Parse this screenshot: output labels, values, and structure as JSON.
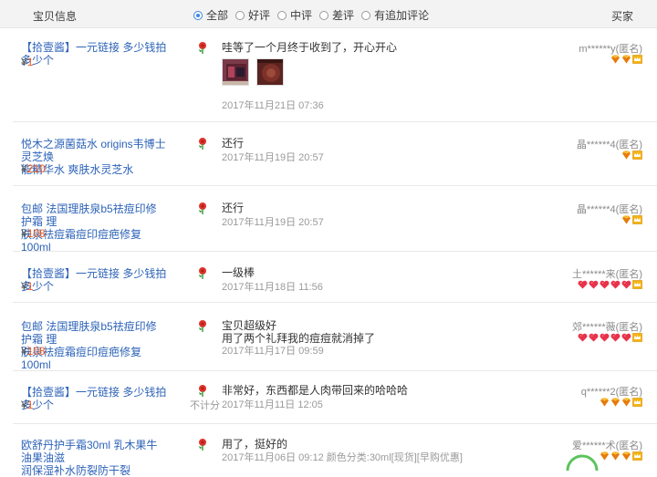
{
  "header": {
    "item_col": "宝贝信息",
    "buyer_col": "买家",
    "filters": [
      "全部",
      "好评",
      "中评",
      "差评",
      "有追加评论"
    ]
  },
  "rows": [
    {
      "title_lines": [
        "【拾壹酱】一元链接 多少钱拍多少个"
      ],
      "price": "1",
      "comment_lines": [
        "哇等了一个月终于收到了，开心开心"
      ],
      "date": "2017年11月21日 07:36",
      "buyer": "m******y(匿名)",
      "badges": [
        "gem",
        "gem",
        "crown"
      ],
      "has_images": true
    },
    {
      "title_lines": [
        "悦木之源菌菇水 origins韦博士灵芝焕",
        "能精华水 爽肤水灵芝水"
      ],
      "price": "210",
      "comment_lines": [
        "还行"
      ],
      "date": "2017年11月19日 20:57",
      "buyer": "晶******4(匿名)",
      "badges": [
        "gem",
        "crown"
      ]
    },
    {
      "title_lines": [
        "包邮 法国理肤泉b5祛痘印修护霜 理",
        "肤泉祛痘霜痘印痘疤修复 100ml"
      ],
      "price": "108",
      "comment_lines": [
        "还行"
      ],
      "date": "2017年11月19日 20:57",
      "buyer": "晶******4(匿名)",
      "badges": [
        "gem",
        "crown"
      ]
    },
    {
      "title_lines": [
        "【拾壹酱】一元链接 多少钱拍多少个"
      ],
      "price": "1",
      "comment_lines": [
        "一级棒"
      ],
      "date": "2017年11月18日 11:56",
      "buyer": "土******来(匿名)",
      "badges": [
        "heart",
        "heart",
        "heart",
        "heart",
        "heart",
        "crown"
      ]
    },
    {
      "title_lines": [
        "包邮 法国理肤泉b5祛痘印修护霜 理",
        "肤泉祛痘霜痘印痘疤修复 100ml"
      ],
      "price": "108",
      "comment_lines": [
        "宝贝超级好",
        "用了两个礼拜我的痘痘就消掉了"
      ],
      "date": "2017年11月17日 09:59",
      "buyer": "郊******薇(匿名)",
      "badges": [
        "heart",
        "heart",
        "heart",
        "heart",
        "heart",
        "crown"
      ]
    },
    {
      "title_lines": [
        "【拾壹酱】一元链接 多少钱拍多少个"
      ],
      "price": "1",
      "comment_lines": [
        "非常好，东西都是人肉带回来的哈哈哈"
      ],
      "date": "2017年11月11日 12:05",
      "buyer": "q******2(匿名)",
      "badges": [
        "gem",
        "gem",
        "gem",
        "crown"
      ],
      "no_score": "不计分"
    },
    {
      "title_lines": [
        "欧舒丹护手霜30ml 乳木果牛油果油滋",
        "润保湿补水防裂防干裂"
      ],
      "price": "",
      "comment_lines": [
        "用了，挺好的"
      ],
      "date": "2017年11月06日 09:12 颜色分类:30ml[现货][早购优惠]",
      "buyer": "爱******术(匿名)",
      "badges": [
        "gem",
        "gem",
        "gem",
        "crown"
      ]
    }
  ],
  "colors": {
    "link": "#2d63b8",
    "price": "#f05a1d",
    "radio_checked": "#3b88e0"
  }
}
